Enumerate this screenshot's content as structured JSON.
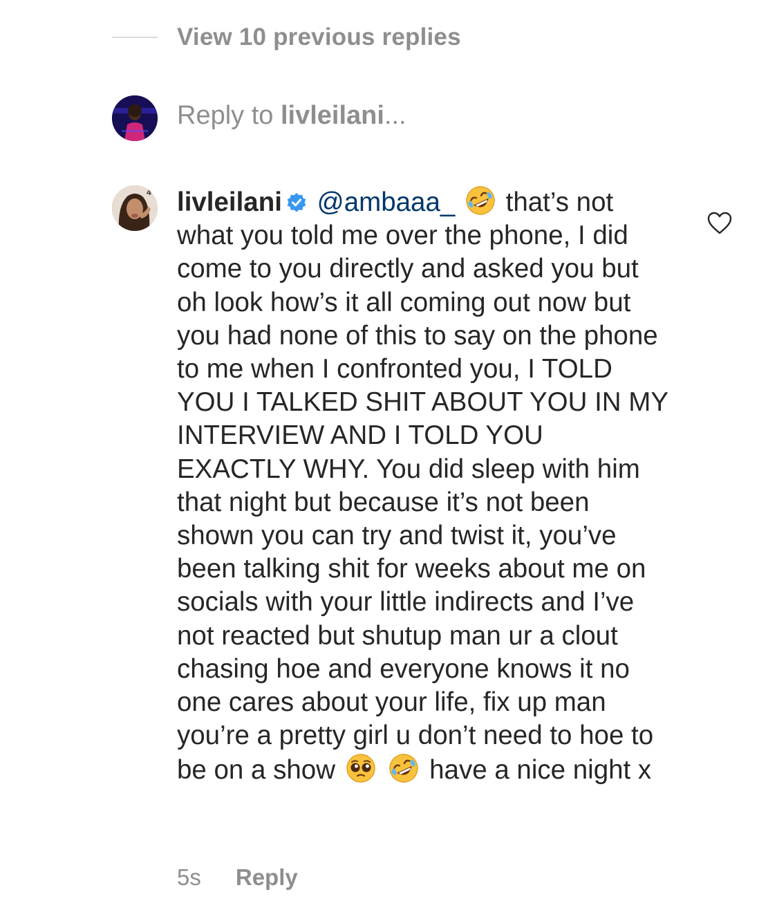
{
  "thread": {
    "view_previous_label": "View 10 previous replies"
  },
  "reply_box": {
    "prefix": "Reply to ",
    "username": "livleilani",
    "suffix": "..."
  },
  "comment": {
    "username": "livleilani",
    "verified": true,
    "mention": "@ambaaa_",
    "emoji_1": "rolling-on-floor-laughing",
    "text_1": " that’s not what you told me over the phone, I did come to you directly and asked you but oh look how’s it all coming out now but you had none of this to say on the phone to me when I confronted you, I TOLD YOU I TALKED SHIT ABOUT YOU IN MY INTERVIEW AND I TOLD YOU EXACTLY WHY. You did sleep with him that night but because it’s not been shown you can try and twist it, you’ve been talking shit for weeks about me on socials with your little indirects and I’ve not reacted but shutup man ur a clout chasing hoe and everyone knows it no one cares about your life, fix up man you’re a pretty girl u don’t need to hoe to be on a show ",
    "emoji_2": "pleading-face",
    "emoji_3": "rolling-on-floor-laughing",
    "text_2": " have a nice night x",
    "time": "5s",
    "reply_label": "Reply",
    "like_icon": "heart-outline-icon"
  },
  "colors": {
    "secondary_text": "#8e8e8e",
    "primary_text": "#262626",
    "mention": "#00376b",
    "verified": "#3897f0"
  }
}
